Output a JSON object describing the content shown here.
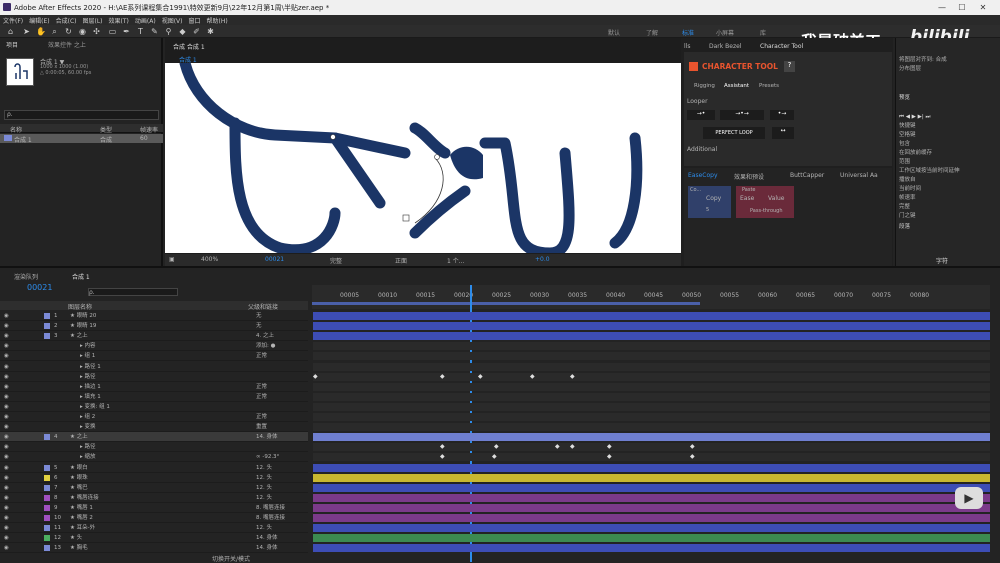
{
  "window": {
    "title": "Adobe After Effects 2020 - H:\\AE系列课程集合1991\\特效更新9月\\22年12月第1周\\半贴zer.aep *",
    "controls": [
      "—",
      "☐",
      "✕"
    ]
  },
  "menu": [
    "文件(F)",
    "编辑(E)",
    "合成(C)",
    "图层(L)",
    "效果(T)",
    "动画(A)",
    "视图(V)",
    "窗口",
    "帮助(H)"
  ],
  "workspaces": [
    "默认",
    "了解",
    "标准",
    "小屏幕",
    "库"
  ],
  "watermark": "我是破美工",
  "bilibili": "bilibili",
  "project": {
    "tab1": "项目",
    "tab2": "效果控件 之上",
    "comp_name": "合成 1 ▼",
    "comp_info1": "1000 x 1000 (1.00)",
    "comp_info2": "△ 0:00:05, 60.00 fps",
    "search_placeholder": "ρ.",
    "col_name": "名称",
    "col_type": "类型",
    "col_size": "帧速率",
    "item_name": "合成 1",
    "item_type": "合成",
    "item_fps": "60"
  },
  "composition": {
    "tab": "合成 合成 1",
    "breadcrumb": "合成 1",
    "zoom": "400%",
    "timecode": "00021",
    "quality": "完整",
    "camera": "正面",
    "views": "1 个...",
    "exposure": "+0.0"
  },
  "character_tool": {
    "title": "CHARACTER TOOL",
    "help": "?",
    "tabs": [
      "Rigging",
      "Assistant",
      "Presets"
    ],
    "active_tab": "Assistant",
    "looper": "Looper",
    "perfect_loop": "PERFECT LOOP",
    "additional": "Additional",
    "panel_tabs": [
      "lls",
      "Dark Bezel",
      "Character Tool"
    ]
  },
  "ease": {
    "tabs": [
      "EaseCopy",
      "效果和预设",
      "ButtCapper",
      "Universal Aa"
    ],
    "copy_title": "Co...",
    "copy_btn": "Copy",
    "paste_title": "Paste",
    "ease_btn": "Ease",
    "value_btn": "Value",
    "pass": "Pass-through",
    "num": "5"
  },
  "right_panel": {
    "items": [
      "对齐",
      "将图层对齐到: 合成",
      "分布图层",
      "预览",
      "快捷键",
      "空格键",
      "包含",
      "在回放前缓存",
      "范围",
      "工作区域按当前时间延伸",
      "播放自",
      "当前时间",
      "帧速率",
      "跳过",
      "分辨率",
      "自动",
      "0",
      "完整",
      "门之键",
      "段落",
      "字符"
    ]
  },
  "timeline": {
    "tab_render": "渲染队列",
    "tab_comp": "合成 1",
    "timecode": "00021",
    "search": "ρ.",
    "col_name": "图层名称",
    "col_parent": "父级和链接",
    "switch_label": "切换开关/模式",
    "ruler": [
      "00005",
      "00010",
      "00015",
      "00020",
      "00025",
      "00030",
      "00035",
      "00040",
      "00045",
      "00050",
      "00055",
      "00060",
      "00065",
      "00070",
      "00075",
      "00080"
    ]
  },
  "layers": [
    {
      "num": "1",
      "name": "眼睛 20",
      "parent": "无",
      "color": "#7b8ad6"
    },
    {
      "num": "2",
      "name": "眼睛 19",
      "parent": "无",
      "color": "#7b8ad6"
    },
    {
      "num": "3",
      "name": "之上",
      "parent": "4. 之上",
      "color": "#7b8ad6"
    },
    {
      "num": "",
      "name": "内容",
      "parent": "添加: ●",
      "color": ""
    },
    {
      "num": "",
      "name": "组 1",
      "parent": "正常",
      "color": ""
    },
    {
      "num": "",
      "name": "路径 1",
      "parent": "",
      "color": ""
    },
    {
      "num": "",
      "name": "路径",
      "parent": "",
      "color": ""
    },
    {
      "num": "",
      "name": "描边 1",
      "parent": "正常",
      "color": ""
    },
    {
      "num": "",
      "name": "填充 1",
      "parent": "正常",
      "color": ""
    },
    {
      "num": "",
      "name": "变换: 组 1",
      "parent": "",
      "color": ""
    },
    {
      "num": "",
      "name": "组 2",
      "parent": "正常",
      "color": ""
    },
    {
      "num": "",
      "name": "变换",
      "parent": "重置",
      "color": ""
    },
    {
      "num": "4",
      "name": "之上",
      "parent": "14. 身体",
      "color": "#7b8ad6"
    },
    {
      "num": "",
      "name": "路径",
      "parent": "",
      "color": ""
    },
    {
      "num": "",
      "name": "缩放",
      "parent": "∞ -92.3°",
      "color": ""
    },
    {
      "num": "5",
      "name": "眼白",
      "parent": "12. 头",
      "color": "#7b8ad6"
    },
    {
      "num": "6",
      "name": "眼珠",
      "parent": "12. 头",
      "color": "#e0d040"
    },
    {
      "num": "7",
      "name": "嘴巴",
      "parent": "12. 头",
      "color": "#7b8ad6"
    },
    {
      "num": "8",
      "name": "嘴唇连接",
      "parent": "12. 头",
      "color": "#a050c0"
    },
    {
      "num": "9",
      "name": "嘴唇 1",
      "parent": "8. 嘴唇连接",
      "color": "#a050c0"
    },
    {
      "num": "10",
      "name": "嘴唇 2",
      "parent": "8. 嘴唇连接",
      "color": "#a050c0"
    },
    {
      "num": "11",
      "name": "耳朵-外",
      "parent": "12. 头",
      "color": "#7b8ad6"
    },
    {
      "num": "12",
      "name": "头",
      "parent": "14. 身体",
      "color": "#4caf60"
    },
    {
      "num": "13",
      "name": "胸毛",
      "parent": "14. 身体",
      "color": "#7b8ad6"
    }
  ],
  "colors": {
    "accent": "#2d8ceb",
    "ct_red": "#e8542e",
    "blue_bar": "#3d4db5",
    "yellow_bar": "#c8b830",
    "purple_bar": "#7b3a8a",
    "green_bar": "#3c8a50",
    "navy": "#1b3566"
  }
}
